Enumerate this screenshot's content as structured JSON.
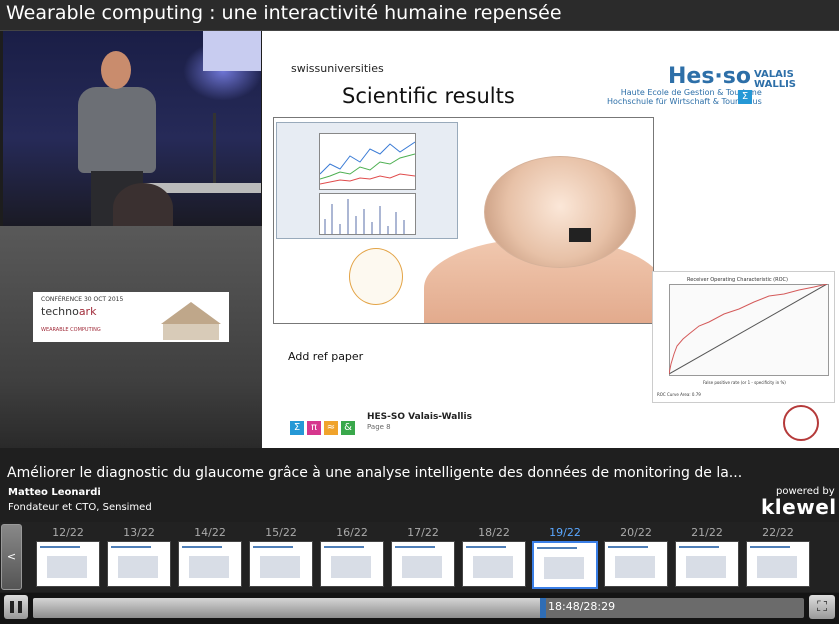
{
  "header": {
    "title": "Wearable computing : une interactivité humaine repensée"
  },
  "sponsor": {
    "line1": "CONFÉRENCE 30 OCT 2015",
    "brand_a": "techno",
    "brand_b": "ark",
    "line3": "WEARABLE COMPUTING"
  },
  "slide": {
    "org": "swissuniversities",
    "title": "Scientific results",
    "hes_brand": "Hes·so",
    "hes_region": "VALAIS WALLIS",
    "hes_school_1": "Haute Ecole de Gestion & Tourisme",
    "hes_school_2": "Hochschule für Wirtschaft & Tourismus",
    "ref_text": "Add ref paper",
    "roc_title": "Receiver Operating Characteristic (ROC)",
    "roc_xlabel": "False positive rate (or 1 - specificity in %)",
    "roc_note": "ROC Curve Area: 0.79",
    "footer_org": "HES-SO Valais-Wallis",
    "footer_page": "Page 8",
    "symbols": [
      "Σ",
      "π",
      "≈",
      "&"
    ]
  },
  "talk": {
    "title": "Améliorer le diagnostic du glaucome grâce à une analyse intelligente des données de monitoring de la...",
    "speaker": "Matteo Leonardi",
    "role": "Fondateur et CTO, Sensimed"
  },
  "branding": {
    "powered": "powered by",
    "name": "klewel"
  },
  "thumbnails": [
    {
      "label": "12/22"
    },
    {
      "label": "13/22"
    },
    {
      "label": "14/22"
    },
    {
      "label": "15/22"
    },
    {
      "label": "16/22"
    },
    {
      "label": "17/22"
    },
    {
      "label": "18/22"
    },
    {
      "label": "19/22",
      "active": true
    },
    {
      "label": "20/22"
    },
    {
      "label": "21/22"
    },
    {
      "label": "22/22"
    }
  ],
  "player": {
    "time": "18:48/28:29",
    "progress": 0.661,
    "prev_glyph": "<",
    "fullscreen_glyph": "⛶"
  },
  "colors": {
    "accent": "#3b7fe6",
    "hes_blue": "#2d6fa8"
  }
}
